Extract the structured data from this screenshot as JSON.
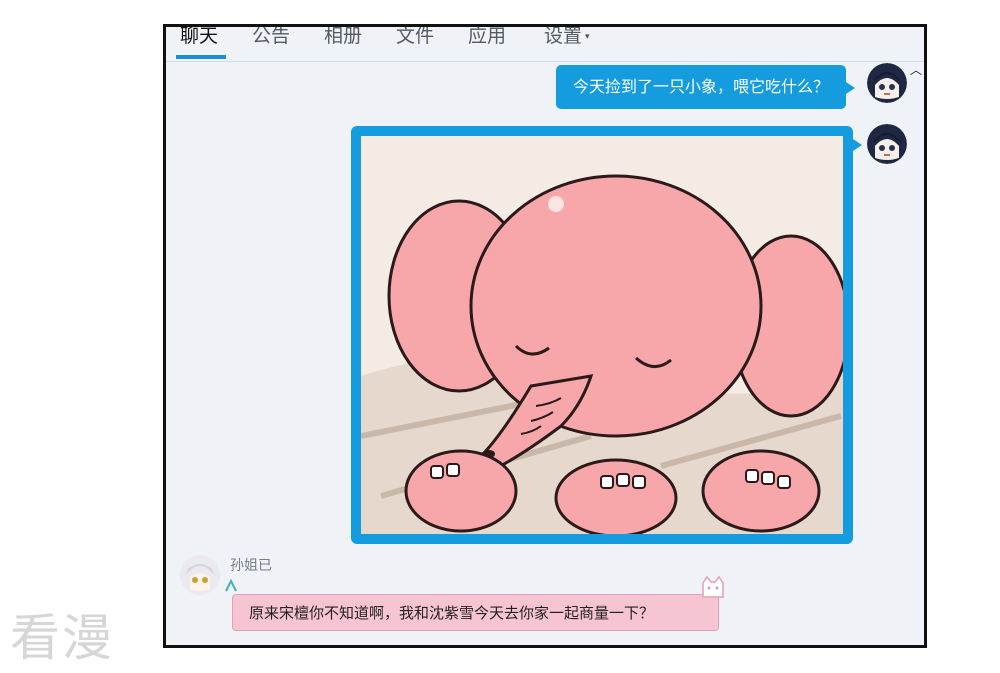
{
  "tabs": [
    {
      "label": "聊天",
      "active": true
    },
    {
      "label": "公告"
    },
    {
      "label": "相册"
    },
    {
      "label": "文件"
    },
    {
      "label": "应用"
    },
    {
      "label": "设置"
    }
  ],
  "settings_caret": "▾",
  "scroll_glyph": "︿",
  "messages": {
    "outgoing_text": "今天捡到了一只小象，喂它吃什么？",
    "incoming_sender": "孙姐已",
    "incoming_text": "原来宋檀你不知道啊，我和沈紫雪今天去你家一起商量一下？"
  },
  "watermark": "看漫",
  "colors": {
    "accent": "#159cdf",
    "pink_bubble": "#f7c4d2",
    "elephant": "#f7a7a9",
    "background": "#eff2f7"
  }
}
